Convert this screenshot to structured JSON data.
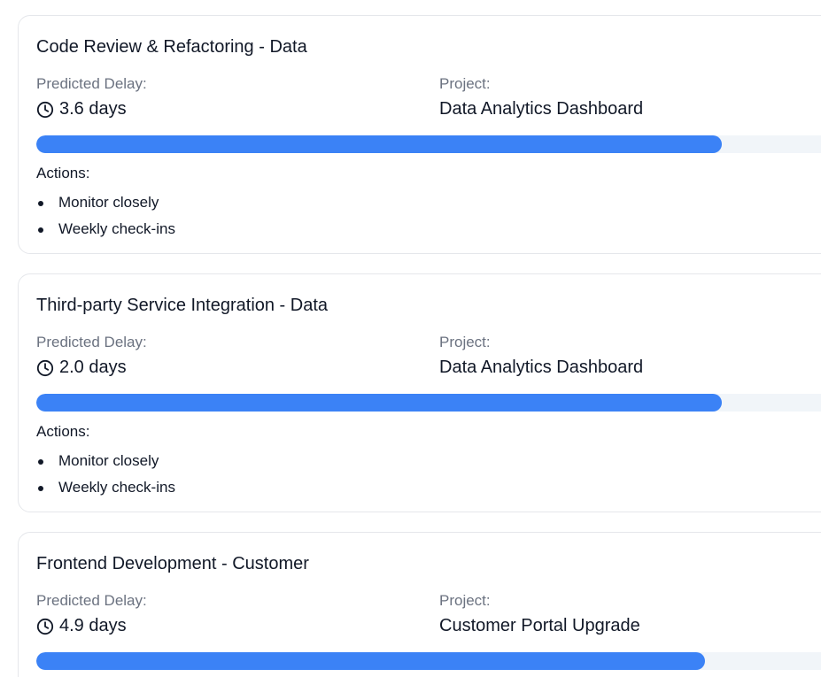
{
  "cards": [
    {
      "title": "Code Review & Refactoring - Data",
      "delay_label": "Predicted Delay:",
      "delay_value": "3.6 days",
      "project_label": "Project:",
      "project_value": "Data Analytics Dashboard",
      "progress_fraction": 0.85,
      "actions_heading": "Actions:",
      "actions": [
        "Monitor closely",
        "Weekly check-ins"
      ]
    },
    {
      "title": "Third-party Service Integration - Data",
      "delay_label": "Predicted Delay:",
      "delay_value": "2.0 days",
      "project_label": "Project:",
      "project_value": "Data Analytics Dashboard",
      "progress_fraction": 0.85,
      "actions_heading": "Actions:",
      "actions": [
        "Monitor closely",
        "Weekly check-ins"
      ]
    },
    {
      "title": "Frontend Development - Customer",
      "delay_label": "Predicted Delay:",
      "delay_value": "4.9 days",
      "project_label": "Project:",
      "project_value": "Customer Portal Upgrade",
      "progress_fraction": 0.83,
      "actions_heading": "",
      "actions": []
    }
  ],
  "colors": {
    "progress_fill": "#3b82f6",
    "progress_track": "#f1f5f9",
    "muted_text": "#6b7280",
    "border": "#e5e7eb"
  },
  "icons": {
    "delay": "clock-icon"
  }
}
